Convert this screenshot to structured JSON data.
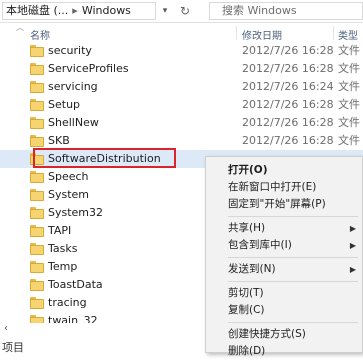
{
  "address": {
    "breadcrumb_drive": "本地磁盘 (...",
    "breadcrumb_sep": "▸",
    "breadcrumb_folder": "Windows",
    "search_placeholder": "搜索 Windows"
  },
  "columns": {
    "name": "名称",
    "date": "修改日期",
    "type": "类型"
  },
  "rows": [
    {
      "name": "security",
      "date": "2012/7/26 16:28",
      "type": "文件"
    },
    {
      "name": "ServiceProfiles",
      "date": "2012/7/26 16:28",
      "type": "文件"
    },
    {
      "name": "servicing",
      "date": "2012/7/26 16:24",
      "type": "文件"
    },
    {
      "name": "Setup",
      "date": "2012/7/26 16:28",
      "type": "文件"
    },
    {
      "name": "ShellNew",
      "date": "2012/7/26 16:28",
      "type": "文件"
    },
    {
      "name": "SKB",
      "date": "2012/7/26 16:28",
      "type": "文件"
    },
    {
      "name": "SoftwareDistribution",
      "date": "",
      "type": ""
    },
    {
      "name": "Speech",
      "date": "",
      "type": ""
    },
    {
      "name": "System",
      "date": "",
      "type": ""
    },
    {
      "name": "System32",
      "date": "",
      "type": ""
    },
    {
      "name": "TAPI",
      "date": "",
      "type": ""
    },
    {
      "name": "Tasks",
      "date": "",
      "type": ""
    },
    {
      "name": "Temp",
      "date": "",
      "type": ""
    },
    {
      "name": "ToastData",
      "date": "",
      "type": ""
    },
    {
      "name": "tracing",
      "date": "",
      "type": ""
    },
    {
      "name": "twain_32",
      "date": "",
      "type": ""
    }
  ],
  "context_menu": {
    "open": "打开(O)",
    "open_new_window": "在新窗口中打开(E)",
    "pin_start": "固定到\"开始\"屏幕(P)",
    "share": "共享(H)",
    "include_library": "包含到库中(I)",
    "send_to": "发送到(N)",
    "cut": "剪切(T)",
    "copy": "复制(C)",
    "create_shortcut": "创建快捷方式(S)",
    "delete": "删除(D)"
  },
  "status": {
    "items_label": "项目"
  },
  "icons": {
    "folder": "folder-icon",
    "search": "search-icon",
    "refresh": "refresh-icon",
    "submenu": "chevron-right-icon"
  }
}
